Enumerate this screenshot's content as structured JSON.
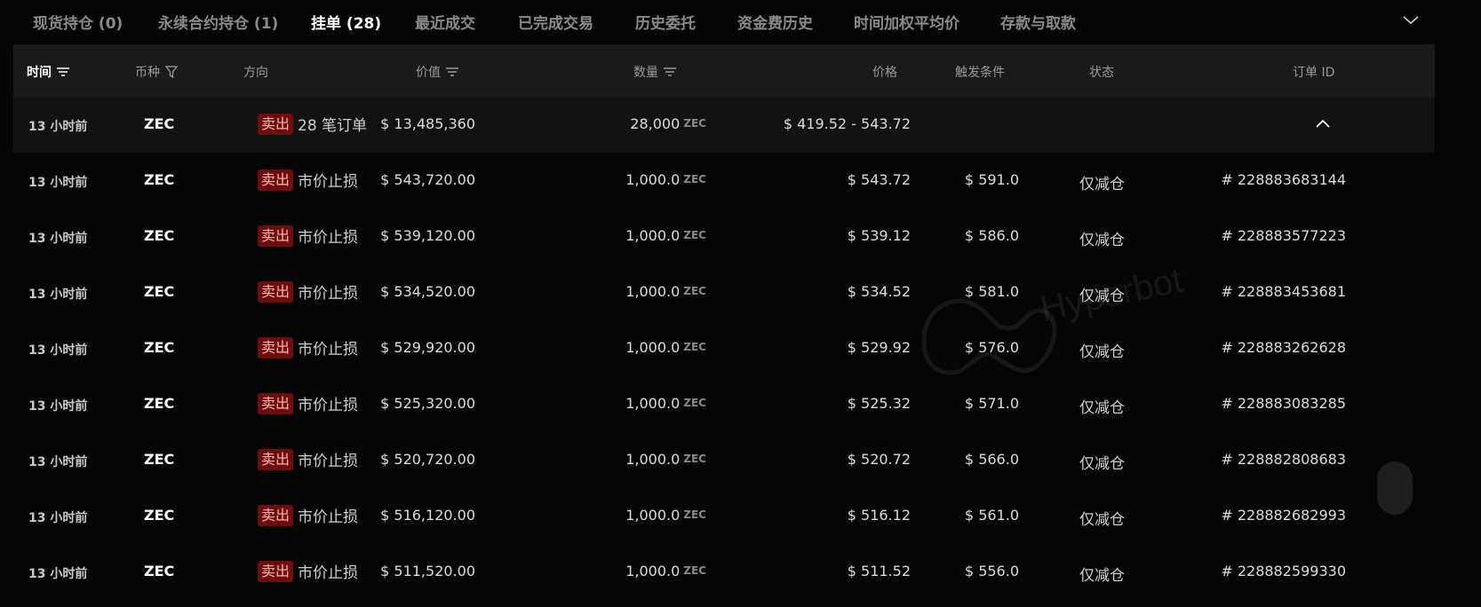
{
  "tabs": [
    {
      "label": "现货持仓 (0)"
    },
    {
      "label": "永续合约持仓 (1)"
    },
    {
      "label": "挂单 (28)"
    },
    {
      "label": "最近成交"
    },
    {
      "label": "已完成交易"
    },
    {
      "label": "历史委托"
    },
    {
      "label": "资金费历史"
    },
    {
      "label": "时间加权平均价"
    },
    {
      "label": "存款与取款"
    }
  ],
  "active_tab": 2,
  "columns": {
    "time": "时间",
    "coin": "币种",
    "direction": "方向",
    "value": "价值",
    "amount": "数量",
    "price": "价格",
    "trigger": "触发条件",
    "status": "状态",
    "order_id": "订单 ID"
  },
  "group_row": {
    "time": "13 小时前",
    "coin": "ZEC",
    "side": "卖出",
    "summary": "28 笔订单",
    "value": "$ 13,485,360",
    "amount": "28,000",
    "unit": "ZEC",
    "price_range": "$ 419.52 - 543.72"
  },
  "rows": [
    {
      "time": "13 小时前",
      "coin": "ZEC",
      "side": "卖出",
      "type": "市价止损",
      "value": "$ 543,720.00",
      "amount": "1,000.0",
      "unit": "ZEC",
      "price": "$ 543.72",
      "trigger": "$ 591.0",
      "status": "仅减仓",
      "order_id": "# 228883683144"
    },
    {
      "time": "13 小时前",
      "coin": "ZEC",
      "side": "卖出",
      "type": "市价止损",
      "value": "$ 539,120.00",
      "amount": "1,000.0",
      "unit": "ZEC",
      "price": "$ 539.12",
      "trigger": "$ 586.0",
      "status": "仅减仓",
      "order_id": "# 228883577223"
    },
    {
      "time": "13 小时前",
      "coin": "ZEC",
      "side": "卖出",
      "type": "市价止损",
      "value": "$ 534,520.00",
      "amount": "1,000.0",
      "unit": "ZEC",
      "price": "$ 534.52",
      "trigger": "$ 581.0",
      "status": "仅减仓",
      "order_id": "# 228883453681"
    },
    {
      "time": "13 小时前",
      "coin": "ZEC",
      "side": "卖出",
      "type": "市价止损",
      "value": "$ 529,920.00",
      "amount": "1,000.0",
      "unit": "ZEC",
      "price": "$ 529.92",
      "trigger": "$ 576.0",
      "status": "仅减仓",
      "order_id": "# 228883262628"
    },
    {
      "time": "13 小时前",
      "coin": "ZEC",
      "side": "卖出",
      "type": "市价止损",
      "value": "$ 525,320.00",
      "amount": "1,000.0",
      "unit": "ZEC",
      "price": "$ 525.32",
      "trigger": "$ 571.0",
      "status": "仅减仓",
      "order_id": "# 228883083285"
    },
    {
      "time": "13 小时前",
      "coin": "ZEC",
      "side": "卖出",
      "type": "市价止损",
      "value": "$ 520,720.00",
      "amount": "1,000.0",
      "unit": "ZEC",
      "price": "$ 520.72",
      "trigger": "$ 566.0",
      "status": "仅减仓",
      "order_id": "# 228882808683"
    },
    {
      "time": "13 小时前",
      "coin": "ZEC",
      "side": "卖出",
      "type": "市价止损",
      "value": "$ 516,120.00",
      "amount": "1,000.0",
      "unit": "ZEC",
      "price": "$ 516.12",
      "trigger": "$ 561.0",
      "status": "仅减仓",
      "order_id": "# 228882682993"
    },
    {
      "time": "13 小时前",
      "coin": "ZEC",
      "side": "卖出",
      "type": "市价止损",
      "value": "$ 511,520.00",
      "amount": "1,000.0",
      "unit": "ZEC",
      "price": "$ 511.52",
      "trigger": "$ 556.0",
      "status": "仅减仓",
      "order_id": "# 228882599330"
    }
  ],
  "watermark": {
    "text": "Hyperbot",
    "icon": "hyperbot-logo-icon"
  },
  "icons": {
    "sort": "sort-icon",
    "filter": "filter-icon",
    "expand": "chevron-down-icon",
    "collapse": "chevron-up-icon"
  },
  "colors": {
    "background": "#050505",
    "header": "#1a1a1a",
    "group_row": "#121212",
    "sell_tag_bg": "#6e0d0d",
    "sell_tag_text": "#ffb3b3"
  }
}
